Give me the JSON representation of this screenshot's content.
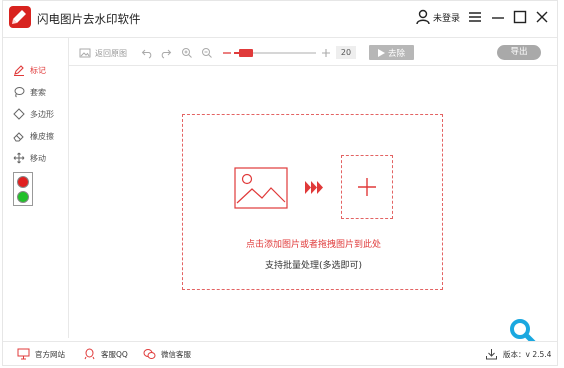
{
  "app": {
    "title": "闪电图片去水印软件"
  },
  "user": {
    "label": "未登录"
  },
  "toolbar": {
    "back_label": "返回原图",
    "zoom_value": "20",
    "remove_label": "去除",
    "export_label": "导出",
    "zoom_slider_fraction": 0.15
  },
  "tools": [
    {
      "label": "标记",
      "icon": "pen-icon",
      "active": true
    },
    {
      "label": "套索",
      "icon": "lasso-icon",
      "active": false
    },
    {
      "label": "多边形",
      "icon": "polygon-icon",
      "active": false
    },
    {
      "label": "橡皮擦",
      "icon": "eraser-icon",
      "active": false
    },
    {
      "label": "移动",
      "icon": "move-icon",
      "active": false
    }
  ],
  "colors": {
    "accent": "#e03a3a",
    "swatch_red": "#e02020",
    "swatch_green": "#22c02a",
    "fab": "#1aa8e0"
  },
  "drop": {
    "hint": "点击添加图片或者拖拽图片到此处",
    "batch": "支持批量处理(多选即可)"
  },
  "footer": {
    "website": "官方网站",
    "qq": "客服QQ",
    "wechat": "微信客服",
    "version": "版本：v 2.5.4"
  }
}
